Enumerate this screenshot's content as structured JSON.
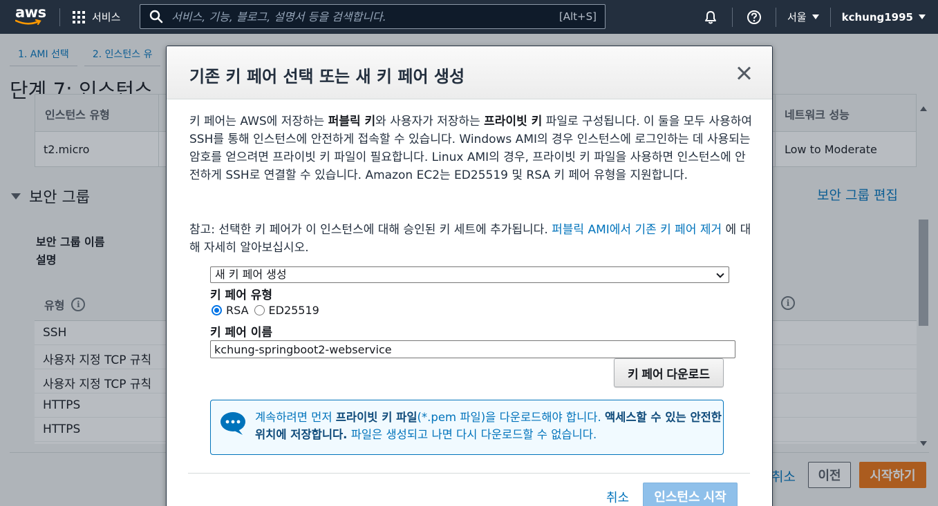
{
  "nav": {
    "logo_text": "aws",
    "services_label": "서비스",
    "search_placeholder": "서비스, 기능, 블로그, 설명서 등을 검색합니다.",
    "search_shortcut": "[Alt+S]",
    "region": "서울",
    "user": "kchung1995"
  },
  "breadcrumbs": [
    "1. AMI 선택",
    "2. 인스턴스 유"
  ],
  "page": {
    "title": "단계 7: 인스턴스",
    "instance_table": {
      "headers": [
        "인스턴스 유형",
        "네트워크 성능"
      ],
      "row": [
        "t2.micro",
        "Low to Moderate"
      ]
    },
    "security_group": {
      "title": "보안 그룹",
      "edit_link": "보안 그룹 편집",
      "name_label": "보안 그룹 이름",
      "desc_label": "설명",
      "type_header": "유형",
      "rows": [
        "SSH",
        "사용자 지정 TCP 규칙",
        "사용자 지정 TCP 규칙",
        "HTTPS",
        "HTTPS"
      ]
    },
    "footer": {
      "cancel": "취소",
      "previous": "이전",
      "launch": "시작하기"
    }
  },
  "modal": {
    "title": "기존 키 페어 선택 또는 새 키 페어 생성",
    "desc": {
      "p1": "키 페어는 AWS에 저장하는 ",
      "b1": "퍼블릭 키",
      "p2": "와 사용자가 저장하는 ",
      "b2": "프라이빗 키",
      "p3": " 파일로 구성됩니다. 이 둘을 모두 사용하여 SSH를 통해 인스턴스에 안전하게 접속할 수 있습니다. Windows AMI의 경우 인스턴스에 로그인하는 데 사용되는 암호를 얻으려면 프라이빗 키 파일이 필요합니다. Linux AMI의 경우, 프라이빗 키 파일을 사용하면 인스턴스에 안전하게 SSH로 연결할 수 있습니다. Amazon EC2는 ED25519 및 RSA 키 페어 유형을 지원합니다."
    },
    "note": {
      "prefix": "참고: 선택한 키 페어가 이 인스턴스에 대해 승인된 키 세트에 추가됩니다. ",
      "link": "퍼블릭 AMI에서 기존 키 페어 제거",
      "suffix": " 에 대해 자세히 알아보십시오."
    },
    "keypair_select": "새 키 페어 생성",
    "keypair_type_label": "키 페어 유형",
    "radio_rsa": "RSA",
    "radio_ed25519": "ED25519",
    "keypair_name_label": "키 페어 이름",
    "keypair_name_value": "kchung-springboot2-webservice",
    "download_button": "키 페어 다운로드",
    "info": {
      "p1": "계속하려면 먼저 ",
      "b1": "프라이빗 키 파일",
      "p2": "(*.pem 파일)을 다운로드해야 합니다. ",
      "b2": "액세스할 수 있는 안전한 위치에 저장합니다.",
      "p3": " 파일은 생성되고 나면 다시 다운로드할 수 없습니다."
    },
    "cancel": "취소",
    "launch": "인스턴스 시작"
  }
}
